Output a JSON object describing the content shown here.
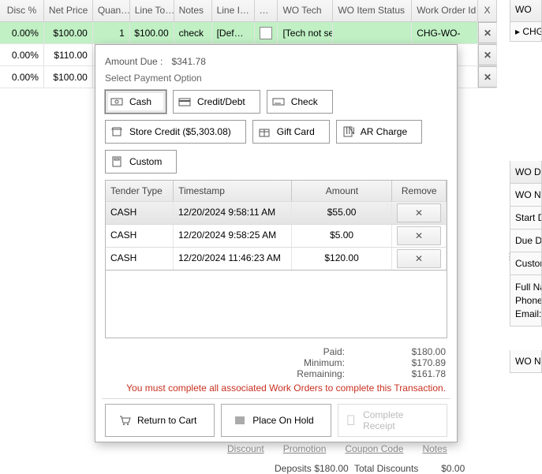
{
  "grid": {
    "headers": [
      "Disc %",
      "Net Price",
      "Quan…",
      "Line To…",
      "Notes",
      "Line I…",
      "…",
      "WO Tech",
      "WO Item Status",
      "Work Order Id",
      "X"
    ],
    "rows": [
      {
        "disc": "0.00%",
        "net": "$100.00",
        "qty": "1",
        "lt": "$100.00",
        "notes": "check",
        "li": "[Def…",
        "tech": "[Tech not set]",
        "wo": "",
        "woid": "CHG-WO-"
      },
      {
        "disc": "0.00%",
        "net": "$110.00",
        "qty": "",
        "lt": "",
        "notes": "",
        "li": "",
        "tech": "",
        "wo": "",
        "woid": ""
      },
      {
        "disc": "0.00%",
        "net": "$100.00",
        "qty": "",
        "lt": "",
        "notes": "",
        "li": "",
        "tech": "",
        "wo": "",
        "woid": ""
      }
    ]
  },
  "right": {
    "header": "WO",
    "item": "CHG"
  },
  "side": {
    "header": "WO D",
    "rows": [
      "WO Num",
      "Start Da",
      "Due Dat",
      "Custome",
      "Full Nam",
      "Phone:",
      "Email:",
      "WO Note"
    ]
  },
  "modal": {
    "title_prefix": "Amount Due :",
    "amount": "$341.78",
    "subtitle": "Select Payment Option",
    "opts": {
      "cash": "Cash",
      "credit": "Credit/Debt",
      "check": "Check",
      "store": "Store Credit ($5,303.08)",
      "gift": "Gift Card",
      "ar": "AR Charge",
      "custom": "Custom"
    },
    "table": {
      "headers": [
        "Tender Type",
        "Timestamp",
        "Amount",
        "Remove"
      ],
      "rows": [
        {
          "type": "CASH",
          "ts": "12/20/2024 9:58:11 AM",
          "amt": "$55.00"
        },
        {
          "type": "CASH",
          "ts": "12/20/2024 9:58:25 AM",
          "amt": "$5.00"
        },
        {
          "type": "CASH",
          "ts": "12/20/2024 11:46:23 AM",
          "amt": "$120.00"
        }
      ]
    },
    "totals": {
      "paid_lbl": "Paid:",
      "paid": "$180.00",
      "min_lbl": "Minimum:",
      "min": "$170.89",
      "rem_lbl": "Remaining:",
      "rem": "$161.78"
    },
    "warning": "You must complete all associated Work Orders to complete this Transaction.",
    "footer": {
      "return": "Return to Cart",
      "hold": "Place On Hold",
      "complete": "Complete Receipt"
    }
  },
  "links": {
    "discount": "Discount",
    "promo": "Promotion",
    "coupon": "Coupon Code",
    "notes": "Notes"
  },
  "bottom": {
    "deposits_lbl": "Deposits",
    "deposits": "$180.00",
    "discounts_lbl": "Total Discounts",
    "discounts": "$0.00"
  },
  "glyph": {
    "x": "✕",
    "tri": "▸"
  }
}
